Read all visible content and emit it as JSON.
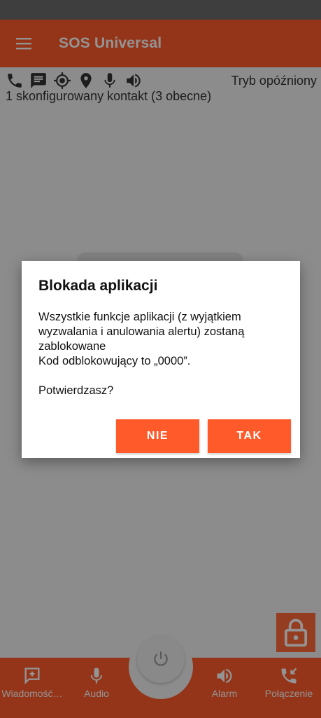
{
  "app_bar": {
    "title": "SOS Universal",
    "menu_icon": "hamburger-menu-icon",
    "color": "#ff5a2a"
  },
  "status": {
    "icons": [
      "phone-icon",
      "message-icon",
      "gps-target-icon",
      "location-pin-icon",
      "microphone-icon",
      "speaker-icon"
    ],
    "mode_label": "Tryb opóźniony",
    "contacts_text": "1 skonfigurowany kontakt (3 obecne)"
  },
  "bottom_nav": {
    "items": [
      {
        "label": "Wiadomość…",
        "icon": "add-message-icon"
      },
      {
        "label": "Audio",
        "icon": "microphone-icon"
      },
      {
        "label": "Alarm",
        "icon": "speaker-icon"
      },
      {
        "label": "Połączenie",
        "icon": "incoming-call-icon"
      }
    ],
    "center_icon": "power-icon"
  },
  "lock_fab": {
    "icon": "lock-icon"
  },
  "dialog": {
    "title": "Blokada aplikacji",
    "body_line1": "Wszystkie funkcje aplikacji (z wyjątkiem wyzwalania i anulowania alertu) zostaną zablokowane",
    "body_line2": "Kod odblokowujący to „0000”.",
    "question": "Potwierdzasz?",
    "no_label": "NIE",
    "yes_label": "TAK"
  }
}
